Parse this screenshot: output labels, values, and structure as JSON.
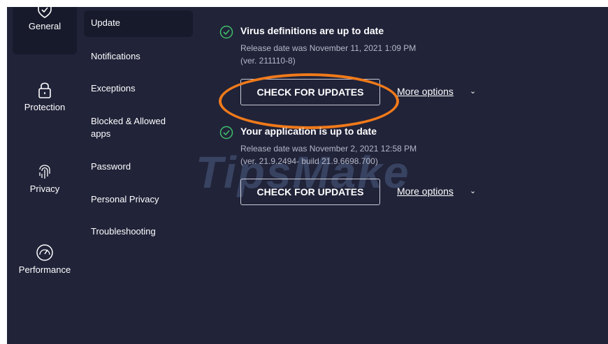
{
  "rail": {
    "items": [
      {
        "label": "General",
        "icon": "shield-icon",
        "active": true
      },
      {
        "label": "Protection",
        "icon": "lock-icon",
        "active": false
      },
      {
        "label": "Privacy",
        "icon": "fingerprint-icon",
        "active": false
      },
      {
        "label": "Performance",
        "icon": "speedometer-icon",
        "active": false
      }
    ]
  },
  "submenu": {
    "items": [
      {
        "label": "Update",
        "active": true
      },
      {
        "label": "Notifications"
      },
      {
        "label": "Exceptions"
      },
      {
        "label": "Blocked & Allowed apps"
      },
      {
        "label": "Password"
      },
      {
        "label": "Personal Privacy"
      },
      {
        "label": "Troubleshooting"
      }
    ]
  },
  "main": {
    "virus": {
      "title": "Virus definitions are up to date",
      "line1": "Release date was November 11, 2021 1:09 PM",
      "line2": "(ver. 211110-8)",
      "button": "CHECK FOR UPDATES",
      "more": "More options"
    },
    "app": {
      "title": "Your application is up to date",
      "line1": "Release date was November 2, 2021 12:58 PM",
      "line2": "(ver. 21.9.2494- build 21.9.6698.700)",
      "button": "CHECK FOR UPDATES",
      "more": "More options"
    }
  },
  "watermark": "TipsMake",
  "colors": {
    "background": "#212339",
    "active_item": "#171a2b",
    "check_green": "#3fbf6a",
    "highlight": "#f07a1a"
  }
}
